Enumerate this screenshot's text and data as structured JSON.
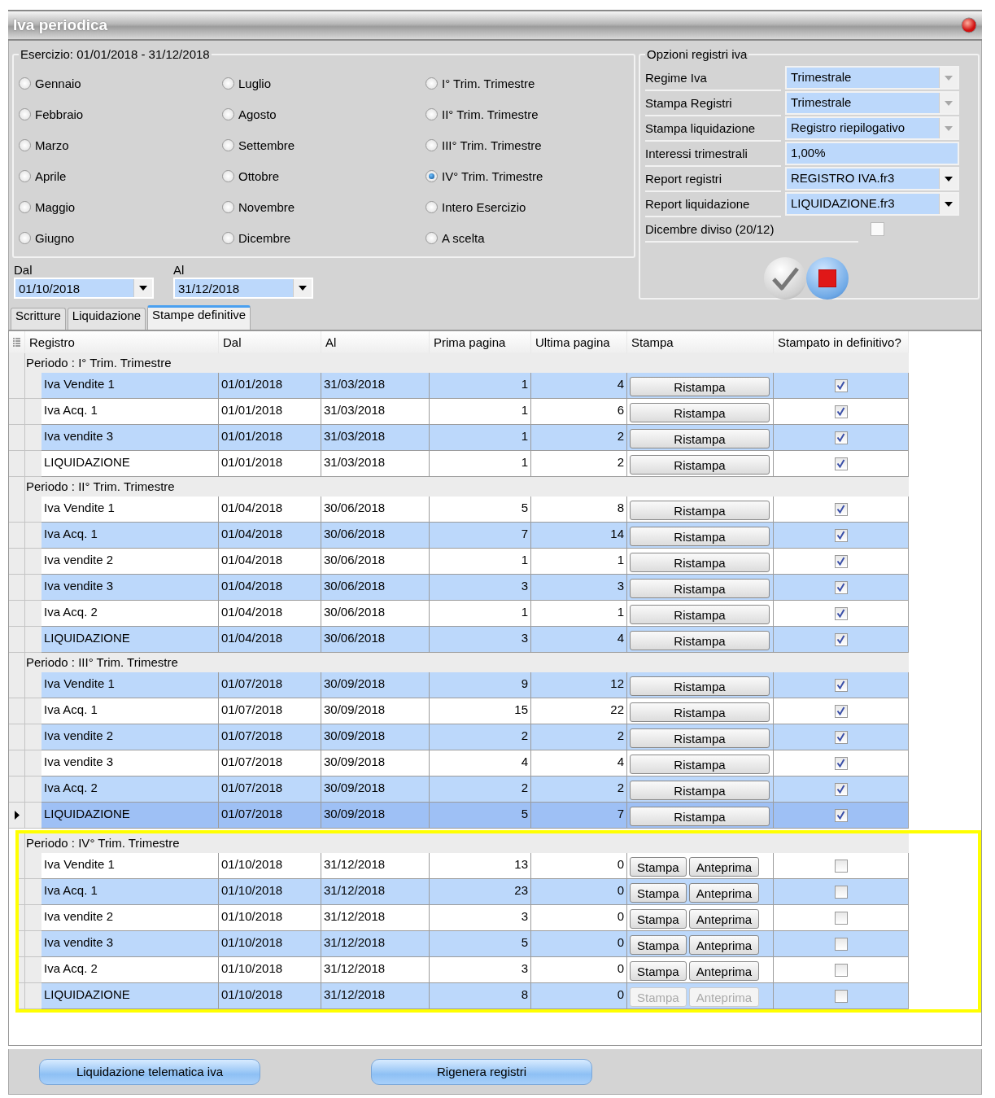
{
  "window": {
    "title": "Iva periodica"
  },
  "esercizio": {
    "title": "Esercizio: 01/01/2018 - 31/12/2018",
    "options": [
      {
        "label": "Gennaio",
        "selected": false
      },
      {
        "label": "Febbraio",
        "selected": false
      },
      {
        "label": "Marzo",
        "selected": false
      },
      {
        "label": "Aprile",
        "selected": false
      },
      {
        "label": "Maggio",
        "selected": false
      },
      {
        "label": "Giugno",
        "selected": false
      },
      {
        "label": "Luglio",
        "selected": false
      },
      {
        "label": "Agosto",
        "selected": false
      },
      {
        "label": "Settembre",
        "selected": false
      },
      {
        "label": "Ottobre",
        "selected": false
      },
      {
        "label": "Novembre",
        "selected": false
      },
      {
        "label": "Dicembre",
        "selected": false
      },
      {
        "label": "I° Trim. Trimestre",
        "selected": false
      },
      {
        "label": "II° Trim. Trimestre",
        "selected": false
      },
      {
        "label": "III° Trim. Trimestre",
        "selected": false
      },
      {
        "label": "IV° Trim. Trimestre",
        "selected": true
      },
      {
        "label": "Intero Esercizio",
        "selected": false
      },
      {
        "label": "A scelta",
        "selected": false
      }
    ]
  },
  "range": [
    {
      "label": "Dal",
      "value": "01/10/2018"
    },
    {
      "label": "Al",
      "value": "31/12/2018"
    }
  ],
  "options_panel": {
    "title": "Opzioni registri iva",
    "fields": [
      {
        "label": "Regime Iva",
        "kind": "combo",
        "value": "Trimestrale",
        "disabled": true
      },
      {
        "label": "Stampa Registri",
        "kind": "combo",
        "value": "Trimestrale",
        "disabled": true
      },
      {
        "label": "Stampa liquidazione",
        "kind": "combo",
        "value": "Registro riepilogativo",
        "disabled": true
      },
      {
        "label": "Interessi trimestrali",
        "kind": "text",
        "value": "1,00%"
      },
      {
        "label": "Report registri",
        "kind": "combo",
        "value": "REGISTRO IVA.fr3",
        "disabled": false
      },
      {
        "label": "Report liquidazione",
        "kind": "combo",
        "value": "LIQUIDAZIONE.fr3",
        "disabled": false
      },
      {
        "label": "Dicembre diviso (20/12)",
        "kind": "checkbox",
        "checked": false
      }
    ]
  },
  "tabs": [
    {
      "label": "Scritture",
      "selected": false
    },
    {
      "label": "Liquidazione",
      "selected": false
    },
    {
      "label": "Stampe definitive",
      "selected": true
    }
  ],
  "table": {
    "columns": [
      "Registro",
      "Dal",
      "Al",
      "Prima pagina",
      "Ultima pagina",
      "Stampa",
      "Stampato in definitivo?"
    ],
    "groups": [
      {
        "title": "Periodo : I° Trim. Trimestre",
        "highlighted": false,
        "rows": [
          {
            "registro": "Iva Vendite 1",
            "dal": "01/01/2018",
            "al": "31/03/2018",
            "prima": "1",
            "ultima": "4",
            "selected": false,
            "actions": [
              {
                "label": "Ristampa",
                "disabled": false
              }
            ],
            "printed": true
          },
          {
            "registro": "Iva Acq. 1",
            "dal": "01/01/2018",
            "al": "31/03/2018",
            "prima": "1",
            "ultima": "6",
            "selected": false,
            "actions": [
              {
                "label": "Ristampa",
                "disabled": false
              }
            ],
            "printed": true
          },
          {
            "registro": "Iva vendite 3",
            "dal": "01/01/2018",
            "al": "31/03/2018",
            "prima": "1",
            "ultima": "2",
            "selected": false,
            "actions": [
              {
                "label": "Ristampa",
                "disabled": false
              }
            ],
            "printed": true
          },
          {
            "registro": "LIQUIDAZIONE",
            "dal": "01/01/2018",
            "al": "31/03/2018",
            "prima": "1",
            "ultima": "2",
            "selected": false,
            "actions": [
              {
                "label": "Ristampa",
                "disabled": false
              }
            ],
            "printed": true
          }
        ]
      },
      {
        "title": "Periodo : II° Trim. Trimestre",
        "highlighted": false,
        "rows": [
          {
            "registro": "Iva Vendite 1",
            "dal": "01/04/2018",
            "al": "30/06/2018",
            "prima": "5",
            "ultima": "8",
            "selected": false,
            "actions": [
              {
                "label": "Ristampa",
                "disabled": false
              }
            ],
            "printed": true
          },
          {
            "registro": "Iva Acq. 1",
            "dal": "01/04/2018",
            "al": "30/06/2018",
            "prima": "7",
            "ultima": "14",
            "selected": false,
            "actions": [
              {
                "label": "Ristampa",
                "disabled": false
              }
            ],
            "printed": true
          },
          {
            "registro": "Iva vendite 2",
            "dal": "01/04/2018",
            "al": "30/06/2018",
            "prima": "1",
            "ultima": "1",
            "selected": false,
            "actions": [
              {
                "label": "Ristampa",
                "disabled": false
              }
            ],
            "printed": true
          },
          {
            "registro": "Iva vendite 3",
            "dal": "01/04/2018",
            "al": "30/06/2018",
            "prima": "3",
            "ultima": "3",
            "selected": false,
            "actions": [
              {
                "label": "Ristampa",
                "disabled": false
              }
            ],
            "printed": true
          },
          {
            "registro": "Iva Acq. 2",
            "dal": "01/04/2018",
            "al": "30/06/2018",
            "prima": "1",
            "ultima": "1",
            "selected": false,
            "actions": [
              {
                "label": "Ristampa",
                "disabled": false
              }
            ],
            "printed": true
          },
          {
            "registro": "LIQUIDAZIONE",
            "dal": "01/04/2018",
            "al": "30/06/2018",
            "prima": "3",
            "ultima": "4",
            "selected": false,
            "actions": [
              {
                "label": "Ristampa",
                "disabled": false
              }
            ],
            "printed": true
          }
        ]
      },
      {
        "title": "Periodo : III° Trim. Trimestre",
        "highlighted": false,
        "rows": [
          {
            "registro": "Iva Vendite 1",
            "dal": "01/07/2018",
            "al": "30/09/2018",
            "prima": "9",
            "ultima": "12",
            "selected": false,
            "actions": [
              {
                "label": "Ristampa",
                "disabled": false
              }
            ],
            "printed": true
          },
          {
            "registro": "Iva Acq. 1",
            "dal": "01/07/2018",
            "al": "30/09/2018",
            "prima": "15",
            "ultima": "22",
            "selected": false,
            "actions": [
              {
                "label": "Ristampa",
                "disabled": false
              }
            ],
            "printed": true
          },
          {
            "registro": "Iva vendite 2",
            "dal": "01/07/2018",
            "al": "30/09/2018",
            "prima": "2",
            "ultima": "2",
            "selected": false,
            "actions": [
              {
                "label": "Ristampa",
                "disabled": false
              }
            ],
            "printed": true
          },
          {
            "registro": "Iva vendite 3",
            "dal": "01/07/2018",
            "al": "30/09/2018",
            "prima": "4",
            "ultima": "4",
            "selected": false,
            "actions": [
              {
                "label": "Ristampa",
                "disabled": false
              }
            ],
            "printed": true
          },
          {
            "registro": "Iva Acq. 2",
            "dal": "01/07/2018",
            "al": "30/09/2018",
            "prima": "2",
            "ultima": "2",
            "selected": false,
            "actions": [
              {
                "label": "Ristampa",
                "disabled": false
              }
            ],
            "printed": true
          },
          {
            "registro": "LIQUIDAZIONE",
            "dal": "01/07/2018",
            "al": "30/09/2018",
            "prima": "5",
            "ultima": "7",
            "selected": true,
            "actions": [
              {
                "label": "Ristampa",
                "disabled": false
              }
            ],
            "printed": true
          }
        ]
      },
      {
        "title": "Periodo : IV° Trim. Trimestre",
        "highlighted": true,
        "rows": [
          {
            "registro": "Iva Vendite 1",
            "dal": "01/10/2018",
            "al": "31/12/2018",
            "prima": "13",
            "ultima": "0",
            "selected": false,
            "actions": [
              {
                "label": "Stampa",
                "disabled": false
              },
              {
                "label": "Anteprima",
                "disabled": false
              }
            ],
            "printed": false
          },
          {
            "registro": "Iva Acq. 1",
            "dal": "01/10/2018",
            "al": "31/12/2018",
            "prima": "23",
            "ultima": "0",
            "selected": false,
            "actions": [
              {
                "label": "Stampa",
                "disabled": false
              },
              {
                "label": "Anteprima",
                "disabled": false
              }
            ],
            "printed": false
          },
          {
            "registro": "Iva vendite 2",
            "dal": "01/10/2018",
            "al": "31/12/2018",
            "prima": "3",
            "ultima": "0",
            "selected": false,
            "actions": [
              {
                "label": "Stampa",
                "disabled": false
              },
              {
                "label": "Anteprima",
                "disabled": false
              }
            ],
            "printed": false
          },
          {
            "registro": "Iva vendite 3",
            "dal": "01/10/2018",
            "al": "31/12/2018",
            "prima": "5",
            "ultima": "0",
            "selected": false,
            "actions": [
              {
                "label": "Stampa",
                "disabled": false
              },
              {
                "label": "Anteprima",
                "disabled": false
              }
            ],
            "printed": false
          },
          {
            "registro": "Iva Acq. 2",
            "dal": "01/10/2018",
            "al": "31/12/2018",
            "prima": "3",
            "ultima": "0",
            "selected": false,
            "actions": [
              {
                "label": "Stampa",
                "disabled": false
              },
              {
                "label": "Anteprima",
                "disabled": false
              }
            ],
            "printed": false
          },
          {
            "registro": "LIQUIDAZIONE",
            "dal": "01/10/2018",
            "al": "31/12/2018",
            "prima": "8",
            "ultima": "0",
            "selected": false,
            "actions": [
              {
                "label": "Stampa",
                "disabled": true
              },
              {
                "label": "Anteprima",
                "disabled": true
              }
            ],
            "printed": false
          }
        ]
      }
    ]
  },
  "buttons": [
    "Liquidazione telematica iva",
    "Rigenera registri"
  ]
}
